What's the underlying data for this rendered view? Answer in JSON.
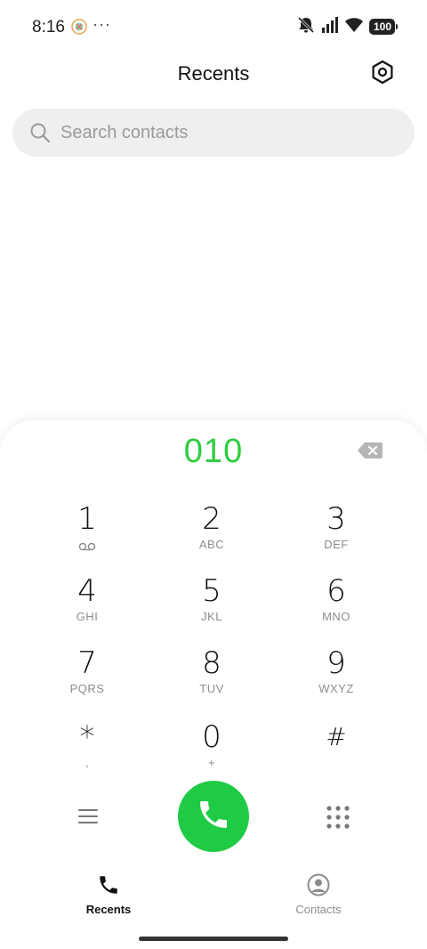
{
  "status_bar": {
    "time": "8:16",
    "more": "···",
    "battery": "100",
    "icons": [
      "app-notification-icon",
      "mute-icon",
      "signal-icon",
      "wifi-icon",
      "battery-icon"
    ]
  },
  "header": {
    "title": "Recents",
    "settings_icon": "settings-icon"
  },
  "search": {
    "placeholder": "Search contacts",
    "value": ""
  },
  "dialer": {
    "number": "010",
    "accent_color": "#2ecc40",
    "call_button_color": "#1fcb44",
    "keys": [
      {
        "digit": "1",
        "letters": ""
      },
      {
        "digit": "2",
        "letters": "ABC"
      },
      {
        "digit": "3",
        "letters": "DEF"
      },
      {
        "digit": "4",
        "letters": "GHI"
      },
      {
        "digit": "5",
        "letters": "JKL"
      },
      {
        "digit": "6",
        "letters": "MNO"
      },
      {
        "digit": "7",
        "letters": "PQRS"
      },
      {
        "digit": "8",
        "letters": "TUV"
      },
      {
        "digit": "9",
        "letters": "WXYZ"
      },
      {
        "digit": "*",
        "letters": ","
      },
      {
        "digit": "0",
        "letters": "+"
      },
      {
        "digit": "#",
        "letters": ""
      }
    ]
  },
  "tabs": [
    {
      "label": "Recents",
      "icon": "phone-icon",
      "active": true
    },
    {
      "label": "Contacts",
      "icon": "contact-person-icon",
      "active": false
    }
  ]
}
